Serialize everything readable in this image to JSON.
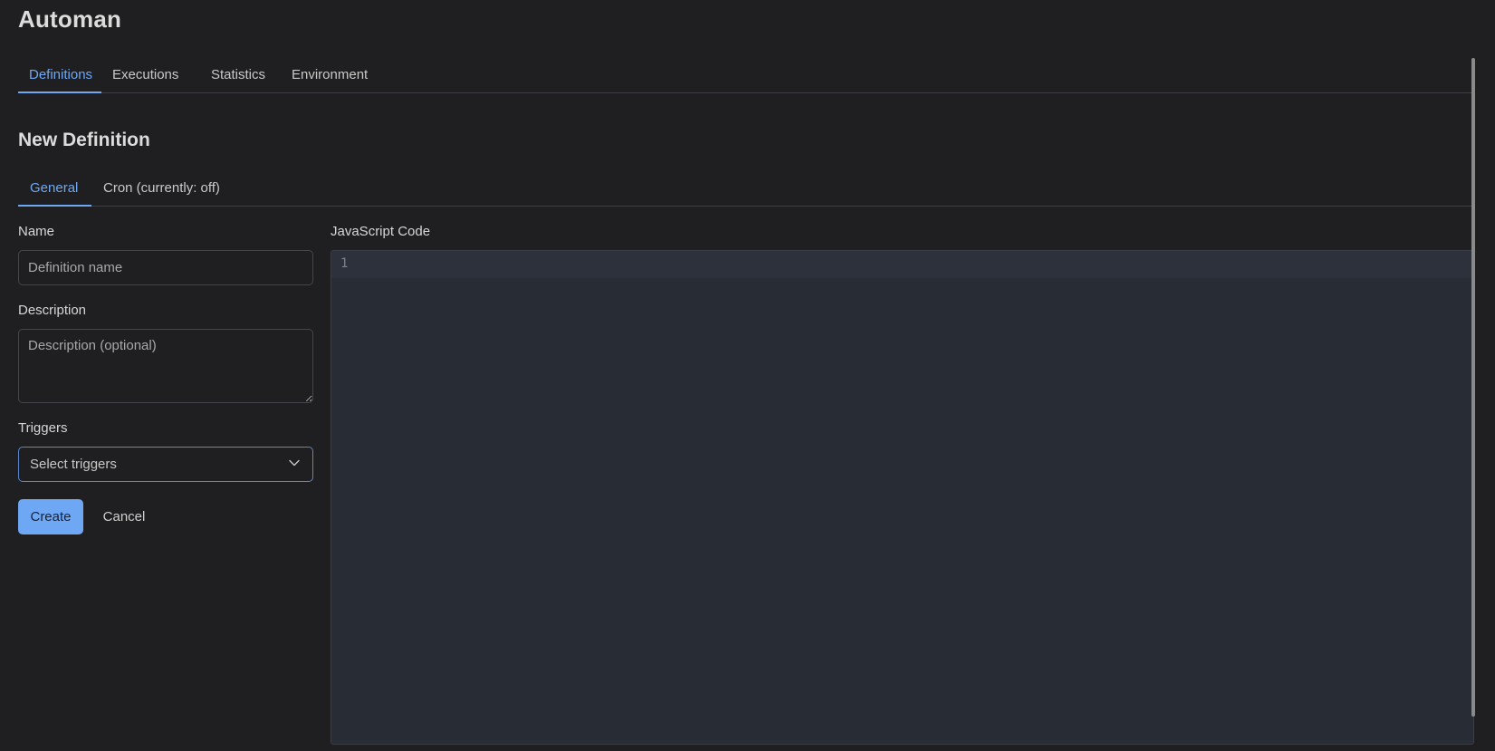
{
  "app": {
    "title": "Automan"
  },
  "top_tabs": [
    {
      "label": "Definitions",
      "active": true
    },
    {
      "label": "Executions",
      "active": false
    },
    {
      "label": "Statistics",
      "active": false
    },
    {
      "label": "Environment",
      "active": false
    }
  ],
  "page": {
    "title": "New Definition"
  },
  "sub_tabs": [
    {
      "label": "General",
      "active": true
    },
    {
      "label": "Cron (currently: off)",
      "active": false
    }
  ],
  "form": {
    "name": {
      "label": "Name",
      "value": "",
      "placeholder": "Definition name"
    },
    "description": {
      "label": "Description",
      "value": "",
      "placeholder": "Description (optional)"
    },
    "triggers": {
      "label": "Triggers",
      "selected": "Select triggers",
      "icon": "chevron-down-icon"
    },
    "create_label": "Create",
    "cancel_label": "Cancel"
  },
  "code": {
    "label": "JavaScript Code",
    "line_numbers": [
      "1"
    ],
    "content": ""
  },
  "colors": {
    "background": "#1f1f21",
    "accent": "#6ea8f5",
    "editor_background": "#282c34",
    "border": "#3e3f44"
  }
}
